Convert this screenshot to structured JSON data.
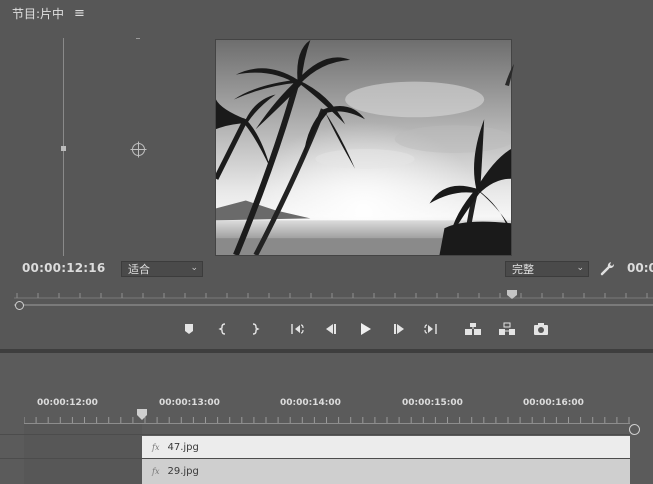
{
  "program_monitor": {
    "title": "节目:片中",
    "menu_icon": "hamburger-icon",
    "current_timecode": "00:00:12:16",
    "duration_timecode_partial": "00:0",
    "fit_dropdown": {
      "value": "适合"
    },
    "quality_dropdown": {
      "value": "完整"
    },
    "settings_icon": "wrench-icon",
    "preview": {
      "description_icon": "preview-image"
    }
  },
  "transport": {
    "buttons": [
      {
        "name": "add-marker-button",
        "icon": "marker-icon"
      },
      {
        "name": "mark-in-button",
        "icon": "mark-in-icon"
      },
      {
        "name": "mark-out-button",
        "icon": "mark-out-icon"
      },
      {
        "name": "go-to-in-button",
        "icon": "go-to-in-icon"
      },
      {
        "name": "step-back-button",
        "icon": "step-back-icon"
      },
      {
        "name": "play-button",
        "icon": "play-icon"
      },
      {
        "name": "step-forward-button",
        "icon": "step-forward-icon"
      },
      {
        "name": "go-to-out-button",
        "icon": "go-to-out-icon"
      },
      {
        "name": "lift-button",
        "icon": "lift-icon"
      },
      {
        "name": "extract-button",
        "icon": "extract-icon"
      },
      {
        "name": "export-frame-button",
        "icon": "camera-icon"
      }
    ]
  },
  "timeline": {
    "time_labels": [
      "00:00:12:00",
      "00:00:13:00",
      "00:00:14:00",
      "00:00:15:00",
      "00:00:16:00"
    ],
    "clips": [
      {
        "fx": "fx",
        "name": "47.jpg"
      },
      {
        "fx": "fx",
        "name": "29.jpg"
      }
    ]
  },
  "colors": {
    "panel_bg": "#575757",
    "clip_selected": "#ececec",
    "clip_normal": "#cfcfcf",
    "text": "#dcdcdc"
  }
}
